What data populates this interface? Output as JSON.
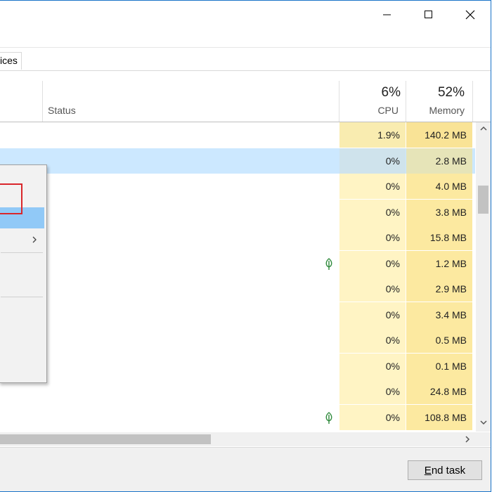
{
  "window": {
    "controls": {
      "minimize_icon": "minimize-icon",
      "maximize_icon": "maximize-icon",
      "close_icon": "close-icon"
    }
  },
  "tabs": {
    "partial_label": "ices"
  },
  "columns": {
    "status": "Status",
    "cpu": {
      "percent": "6%",
      "label": "CPU"
    },
    "memory": {
      "percent": "52%",
      "label": "Memory"
    }
  },
  "rows": [
    {
      "cpu": "1.9%",
      "memory": "140.2 MB",
      "selected": false,
      "eco": false
    },
    {
      "cpu": "0%",
      "memory": "2.8 MB",
      "selected": true,
      "eco": false
    },
    {
      "cpu": "0%",
      "memory": "4.0 MB",
      "selected": false,
      "eco": false
    },
    {
      "cpu": "0%",
      "memory": "3.8 MB",
      "selected": false,
      "eco": false
    },
    {
      "cpu": "0%",
      "memory": "15.8 MB",
      "selected": false,
      "eco": false
    },
    {
      "cpu": "0%",
      "memory": "1.2 MB",
      "selected": false,
      "eco": true
    },
    {
      "cpu": "0%",
      "memory": "2.9 MB",
      "selected": false,
      "eco": false
    },
    {
      "cpu": "0%",
      "memory": "3.4 MB",
      "selected": false,
      "eco": false
    },
    {
      "cpu": "0%",
      "memory": "0.5 MB",
      "selected": false,
      "eco": false
    },
    {
      "cpu": "0%",
      "memory": "0.1 MB",
      "selected": false,
      "eco": false
    },
    {
      "cpu": "0%",
      "memory": "24.8 MB",
      "selected": false,
      "eco": false
    },
    {
      "cpu": "0%",
      "memory": "108.8 MB",
      "selected": false,
      "eco": true
    }
  ],
  "footer": {
    "end_task_prefix": "E",
    "end_task_rest": "nd task"
  },
  "icons": {
    "eco": "leaf-icon",
    "submenu": "chevron-right-icon"
  },
  "colors": {
    "cpu_column": "#fff4c4",
    "memory_column": "#fce9a0",
    "selection": "#cce8ff",
    "menu_highlight": "#91c9f7",
    "annotation": "#d9262b"
  }
}
